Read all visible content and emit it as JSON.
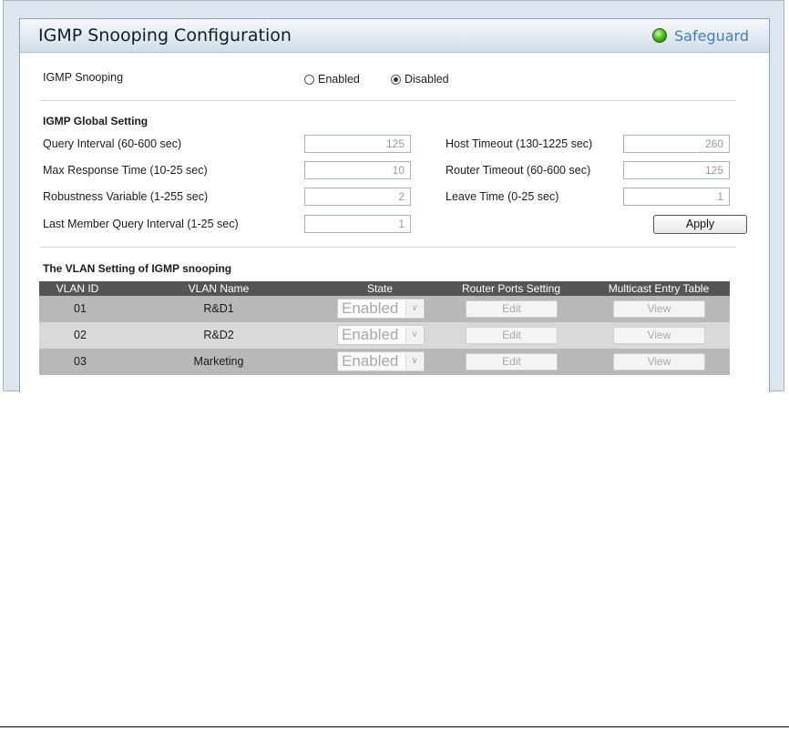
{
  "header": {
    "title": "IGMP Snooping Configuration",
    "safeguard_label": "Safeguard",
    "safeguard_color": "#3b7fc9"
  },
  "igmp_snooping": {
    "label": "IGMP Snooping",
    "options": [
      "Enabled",
      "Disabled"
    ],
    "selected": "Disabled"
  },
  "global": {
    "heading": "IGMP Global Setting",
    "query_interval": {
      "label": "Query Interval (60-600 sec)",
      "value": "125"
    },
    "max_response_time": {
      "label": "Max Response Time (10-25 sec)",
      "value": "10"
    },
    "robustness_variable": {
      "label": "Robustness Variable (1-255 sec)",
      "value": "2"
    },
    "last_member_query_interval": {
      "label": "Last Member Query Interval (1-25 sec)",
      "value": "1"
    },
    "host_timeout": {
      "label": "Host Timeout (130-1225 sec)",
      "value": "260"
    },
    "router_timeout": {
      "label": "Router Timeout (60-600 sec)",
      "value": "125"
    },
    "leave_time": {
      "label": "Leave Time (0-25 sec)",
      "value": "1"
    },
    "apply_label": "Apply"
  },
  "vlan": {
    "heading": "The VLAN Setting of IGMP snooping",
    "columns": [
      "VLAN ID",
      "VLAN Name",
      "State",
      "Router Ports Setting",
      "Multicast Entry Table"
    ],
    "rows": [
      {
        "id": "01",
        "name": "R&D1",
        "state": "Enabled",
        "edit": "Edit",
        "view": "View"
      },
      {
        "id": "02",
        "name": "R&D2",
        "state": "Enabled",
        "edit": "Edit",
        "view": "View"
      },
      {
        "id": "03",
        "name": "Marketing",
        "state": "Enabled",
        "edit": "Edit",
        "view": "View"
      }
    ]
  }
}
